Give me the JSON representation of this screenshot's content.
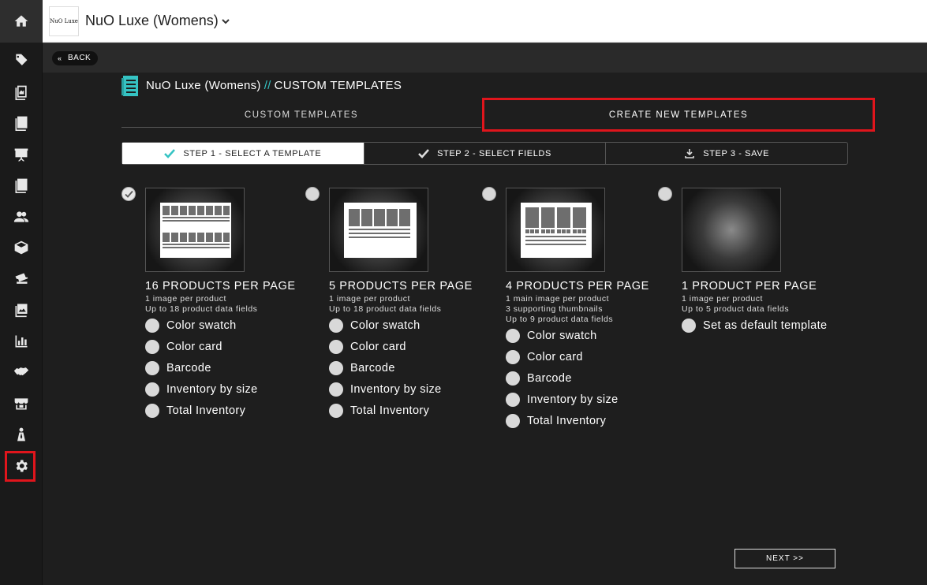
{
  "header": {
    "brand_logo_text": "NuO Luxe",
    "brand_name": "NuO Luxe (Womens)"
  },
  "subbar": {
    "back_label": "BACK"
  },
  "title": {
    "brand": "NuO Luxe (Womens)",
    "separator": "//",
    "section": "CUSTOM TEMPLATES"
  },
  "tabs": {
    "custom": "CUSTOM TEMPLATES",
    "create": "CREATE NEW TEMPLATES"
  },
  "steps": [
    {
      "label": "STEP 1 - SELECT A TEMPLATE",
      "icon": "check-icon",
      "active": true
    },
    {
      "label": "STEP 2 - SELECT FIELDS",
      "icon": "check-icon",
      "active": false
    },
    {
      "label": "STEP 3 - SAVE",
      "icon": "download-icon",
      "active": false
    }
  ],
  "templates": [
    {
      "title": "16 PRODUCTS PER PAGE",
      "desc": [
        "1 image per product",
        "Up to 18 product data fields"
      ],
      "selected": true,
      "options": [
        "Color swatch",
        "Color card",
        "Barcode",
        "Inventory by size",
        "Total Inventory"
      ]
    },
    {
      "title": "5 PRODUCTS PER PAGE",
      "desc": [
        "1 image per product",
        "Up to 18 product data fields"
      ],
      "selected": false,
      "options": [
        "Color swatch",
        "Color card",
        "Barcode",
        "Inventory by size",
        "Total Inventory"
      ]
    },
    {
      "title": "4 PRODUCTS PER PAGE",
      "desc": [
        "1 main image per product",
        "3 supporting thumbnails",
        "Up to 9 product data fields"
      ],
      "selected": false,
      "options": [
        "Color swatch",
        "Color card",
        "Barcode",
        "Inventory by size",
        "Total Inventory"
      ]
    },
    {
      "title": "1 PRODUCT PER PAGE",
      "desc": [
        "1 image per product",
        "Up to 5 product data fields"
      ],
      "selected": false,
      "options": [
        "Set as default template"
      ]
    }
  ],
  "footer": {
    "next_label": "NEXT >>"
  },
  "colors": {
    "accent_teal": "#35c3c3",
    "highlight_red": "#e0151c",
    "background": "#1e1e1e"
  }
}
